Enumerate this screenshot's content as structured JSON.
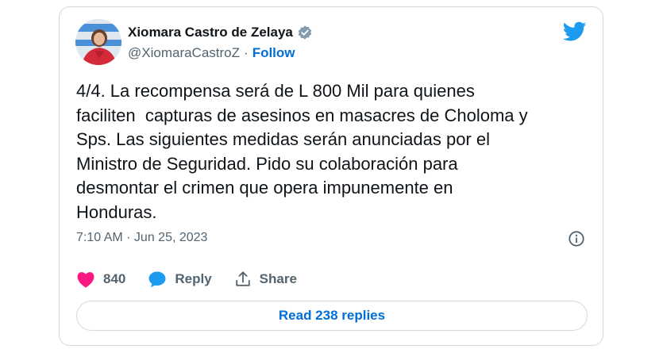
{
  "author": {
    "display_name": "Xiomara Castro de Zelaya",
    "handle": "@XiomaraCastroZ",
    "separator": "·",
    "follow_label": "Follow",
    "verified": true
  },
  "tweet": {
    "text": "4/4. La recompensa será de L 800 Mil para quienes\nfaciliten  capturas de asesinos en masacres de Choloma y\nSps. Las siguientes medidas serán anunciadas por el\nMinistro de Seguridad. Pido su colaboración para\ndesmontar el crimen que opera impunemente en\nHonduras.",
    "timestamp": "7:10 AM · Jun 25, 2023"
  },
  "actions": {
    "like_count": "840",
    "reply_label": "Reply",
    "share_label": "Share"
  },
  "read_replies_label": "Read 238 replies",
  "colors": {
    "brand_blue": "#1d9bf0",
    "link_blue": "#006fd6",
    "like_pink": "#f91880",
    "text": "#0f1419",
    "muted": "#536471",
    "border": "#cfd9de"
  },
  "icons": [
    "verified-badge-icon",
    "twitter-bird-icon",
    "info-icon",
    "heart-icon",
    "reply-bubble-icon",
    "share-icon"
  ]
}
